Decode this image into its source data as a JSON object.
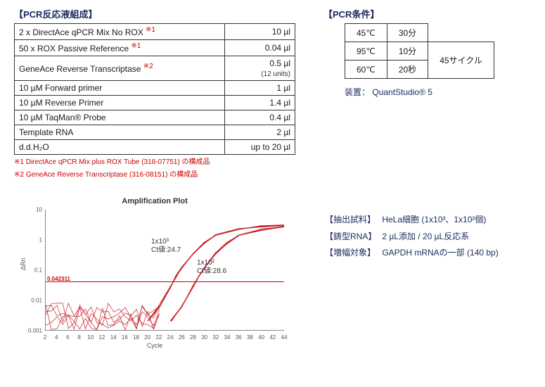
{
  "mix": {
    "title": "【PCR反応液組成】",
    "rows": [
      {
        "name": "2 x DirectAce qPCR Mix No ROX",
        "note": "※1",
        "amount": "10 µl"
      },
      {
        "name": "50 x ROX Passive Reference",
        "note": "※1",
        "amount": "0.04 µl"
      },
      {
        "name": "GeneAce Reverse Transcriptase",
        "note": "※2",
        "amount": "0.5 µl",
        "sub": "(12 units)"
      },
      {
        "name": "10 µM Forward primer",
        "note": "",
        "amount": "1 µl"
      },
      {
        "name": "10 µM Reverse Primer",
        "note": "",
        "amount": "1.4 µl"
      },
      {
        "name": "10 µM TaqMan® Probe",
        "note": "",
        "amount": "0.4 µl"
      },
      {
        "name": "Template RNA",
        "note": "",
        "amount": "2 µl"
      },
      {
        "name": "d.d.H₂O",
        "note": "",
        "amount": "up to 20 µl"
      }
    ],
    "footnote1": "※1 DirectAce qPCR Mix plus ROX Tube (318-07751) の構成品",
    "footnote2": "※2 GeneAce Reverse Transcriptase (316-08151) の構成品"
  },
  "cond": {
    "title": "【PCR条件】",
    "rows": [
      {
        "temp": "45℃",
        "time": "30分"
      },
      {
        "temp": "95℃",
        "time": "10分"
      },
      {
        "temp": "60℃",
        "time": "20秒"
      }
    ],
    "cycles": "45サイクル",
    "equip_label": "装置：",
    "equip_value": "QuantStudio® 5"
  },
  "chart": {
    "title": "Amplification Plot",
    "ylabel": "ΔRn",
    "xlabel": "Cycle",
    "threshold_label": "0.042311",
    "annot1_line1": "1x10³",
    "annot1_line2": "Ct値:24.7",
    "annot2_line1": "1x10²",
    "annot2_line2": "Ct値:28.6"
  },
  "chart_data": {
    "type": "line",
    "xlabel": "Cycle",
    "ylabel": "ΔRn",
    "x_range": [
      2,
      44
    ],
    "y_range_log10": [
      -3,
      1
    ],
    "y_scale": "log",
    "threshold": 0.042311,
    "x_ticks": [
      2,
      4,
      6,
      8,
      10,
      12,
      14,
      16,
      18,
      20,
      22,
      24,
      26,
      28,
      30,
      32,
      34,
      36,
      38,
      40,
      42,
      44
    ],
    "y_ticks": [
      0.001,
      0.01,
      0.1,
      1,
      10
    ],
    "series": [
      {
        "name": "1x10^3 cells",
        "ct": 24.7,
        "replicates": 3,
        "xy_estimated": [
          [
            20,
            0.002
          ],
          [
            22,
            0.006
          ],
          [
            24,
            0.03
          ],
          [
            25,
            0.06
          ],
          [
            26,
            0.12
          ],
          [
            28,
            0.35
          ],
          [
            30,
            0.8
          ],
          [
            32,
            1.4
          ],
          [
            36,
            2.3
          ],
          [
            40,
            2.8
          ],
          [
            44,
            3.0
          ]
        ]
      },
      {
        "name": "1x10^2 cells",
        "ct": 28.6,
        "replicates": 3,
        "xy_estimated": [
          [
            24,
            0.002
          ],
          [
            26,
            0.006
          ],
          [
            28,
            0.03
          ],
          [
            29,
            0.06
          ],
          [
            30,
            0.12
          ],
          [
            32,
            0.35
          ],
          [
            34,
            0.8
          ],
          [
            36,
            1.4
          ],
          [
            40,
            2.2
          ],
          [
            44,
            2.6
          ]
        ]
      }
    ],
    "noise_region_cycles": [
      2,
      22
    ]
  },
  "info": {
    "row1_label": "【抽出試料】",
    "row1_value": "HeLa細胞 (1x10³、1x10²個)",
    "row2_label": "【鋳型RNA】",
    "row2_value": "2 µL添加 / 20 µL反応系",
    "row3_label": "【増幅対象】",
    "row3_value": "GAPDH mRNAの一部 (140 bp)"
  }
}
